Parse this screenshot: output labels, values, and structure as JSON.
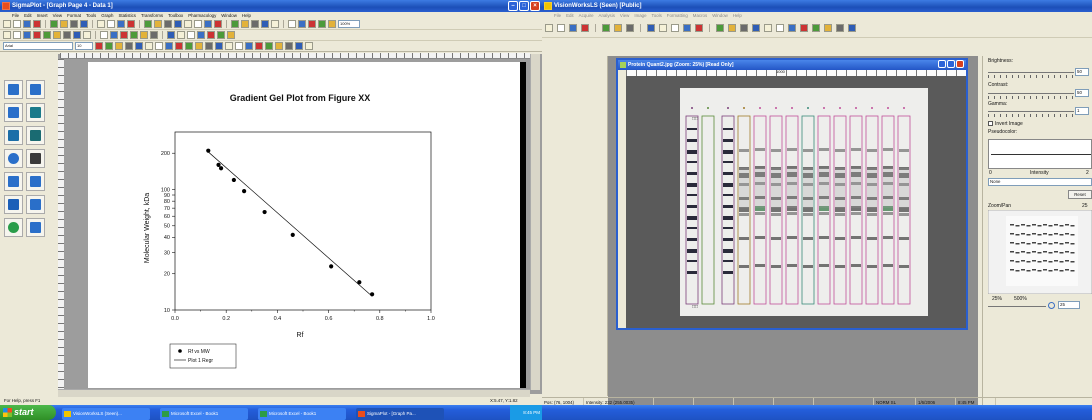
{
  "sigmaplot": {
    "title": "SigmaPlot - [Graph Page 4 - Data 1]",
    "menu": [
      "File",
      "Edit",
      "Insert",
      "View",
      "Format",
      "Tools",
      "Graph",
      "Statistics",
      "Transforms",
      "Toolbox",
      "Pharmacology",
      "Window",
      "Help"
    ],
    "zoom": "100%",
    "style_combo": "Arial",
    "size_combo": "10",
    "status_left": "For Help, press F1",
    "status_right": "X:5.47, Y:1.82",
    "chart_data": {
      "type": "scatter",
      "title": "Gradient Gel Plot from Figure XX",
      "xlabel": "Rf",
      "ylabel": "Molecular Weight, kDa",
      "xlim": [
        0.0,
        1.0
      ],
      "ylim": [
        10,
        300
      ],
      "y_scale": "log",
      "x_ticks": [
        "0.0",
        "0.2",
        "0.4",
        "0.6",
        "0.8",
        "1.0"
      ],
      "y_ticks": [
        "10",
        "20",
        "30",
        "40",
        "50",
        "60",
        "70",
        "80",
        "90",
        "100",
        "200"
      ],
      "series": [
        {
          "name": "Rf vs MW",
          "x": [
            0.13,
            0.17,
            0.18,
            0.23,
            0.27,
            0.35,
            0.46,
            0.61,
            0.72,
            0.77
          ],
          "y": [
            210,
            160,
            150,
            120,
            97,
            65,
            42,
            23,
            17,
            13.5
          ]
        },
        {
          "name": "Plot 1 Regr",
          "x": [
            0.13,
            0.77
          ],
          "y": [
            205,
            13
          ]
        }
      ],
      "legend": [
        "Rf vs MW",
        "Plot 1 Regr"
      ],
      "legend_position": "bottom-left",
      "grid": false
    }
  },
  "visionworks": {
    "title": "VisionWorksLS (Seen) [Public]",
    "menu": [
      "File",
      "Edit",
      "Acquire",
      "Analysis",
      "View",
      "Image",
      "Tools",
      "Formatting",
      "Macros",
      "Window",
      "Help"
    ],
    "inner_title": "Protein Quant2.jpg (Zoom: 25%) [Read Only]",
    "ruler_mark": "1000",
    "tools": [
      "View ROI",
      "Find Lanes Bands",
      "Add Lane",
      "Delete Lane",
      "Add Band",
      "Delete Band",
      "Lane Profile Graph",
      "Molecular Weight",
      "No Correction - 0",
      "Data Explorer",
      "Concentration",
      "Edit Objects",
      "Clear All"
    ],
    "brightness_label": "Brightness:",
    "brightness_value": "50",
    "contrast_label": "Contrast:",
    "contrast_value": "50",
    "gamma_label": "Gamma:",
    "gamma_value": "1",
    "invert_label": "Invert Image",
    "pseudocolor_label": "Pseudocolor:",
    "intensity_min": "0",
    "intensity_label": "Intensity",
    "intensity_max": "2",
    "pseudocolor_value": "None",
    "reset_label": "Reset",
    "zoompan_label": "Zoom/Pan",
    "zoompan_value": "25",
    "zoom_min": "25%",
    "zoom_max": "500%",
    "zoom_value": "25",
    "status": [
      "Pos: (76, 1004)",
      "Intensity: 232 (255.0035)",
      "",
      "",
      "",
      "",
      "",
      "NORM SL",
      "1/6/2006",
      "8:45 PM"
    ]
  },
  "taskbar": {
    "start": "start",
    "buttons": [
      "VisionWorksLS (Seen)...",
      "Microsoft Excel - Book1",
      "Microsoft Excel - Book1",
      "SigmaPlot - [Graph Pa..."
    ],
    "clock": "8:45 PM"
  },
  "colors": {
    "xp_blue": "#2a5fcf",
    "taskbar": "#245edb",
    "start_green": "#3c9b2a"
  }
}
